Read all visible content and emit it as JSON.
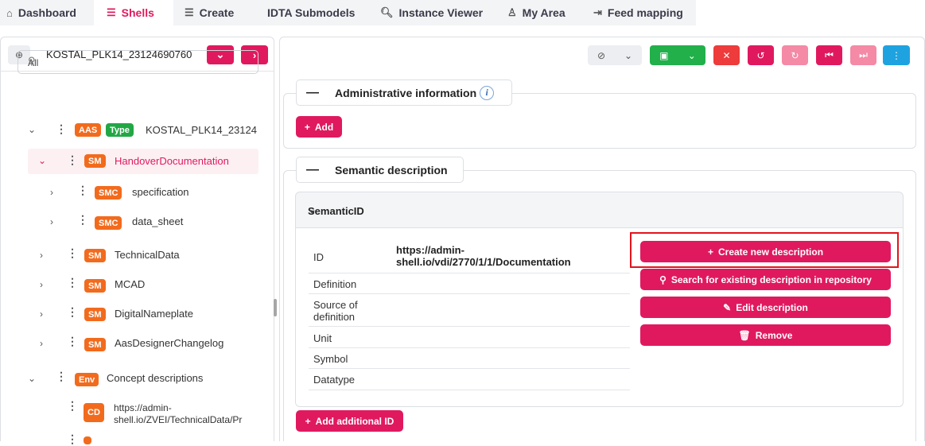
{
  "nav": {
    "tabs": [
      {
        "label": "Dashboard",
        "icon": "home-icon"
      },
      {
        "label": "Shells",
        "icon": "list-icon"
      },
      {
        "label": "Create",
        "icon": "list-icon"
      },
      {
        "label": "IDTA Submodels",
        "icon": ""
      },
      {
        "label": "Instance Viewer",
        "icon": "search-icon"
      },
      {
        "label": "My Area",
        "icon": "user-icon"
      },
      {
        "label": "Feed mapping",
        "icon": "mapping-icon"
      }
    ],
    "active": "Shells"
  },
  "left": {
    "shell_id": "KOSTAL_PLK14_23124690760",
    "filter_value": "All",
    "tree": [
      {
        "badges": [
          "AAS",
          "Type"
        ],
        "label": "KOSTAL_PLK14_23124",
        "expanded": true
      },
      {
        "badges": [
          "SM"
        ],
        "label": "HandoverDocumentation",
        "expanded": true,
        "selected": true
      },
      {
        "badges": [
          "SMC"
        ],
        "label": "specification",
        "expanded": false
      },
      {
        "badges": [
          "SMC"
        ],
        "label": "data_sheet",
        "expanded": false
      },
      {
        "badges": [
          "SM"
        ],
        "label": "TechnicalData",
        "expanded": false
      },
      {
        "badges": [
          "SM"
        ],
        "label": "MCAD",
        "expanded": false
      },
      {
        "badges": [
          "SM"
        ],
        "label": "DigitalNameplate",
        "expanded": false
      },
      {
        "badges": [
          "SM"
        ],
        "label": "AasDesignerChangelog",
        "expanded": false
      },
      {
        "badges": [
          "Env"
        ],
        "label": "Concept descriptions",
        "expanded": true
      },
      {
        "badges": [
          "CD"
        ],
        "label_line1": "https://admin-",
        "label_line2": "shell.io/ZVEI/TechnicalData/Pr"
      }
    ]
  },
  "right": {
    "admin_section": {
      "title": "Administrative information",
      "add_label": "Add"
    },
    "semantic_section": {
      "title": "Semantic description",
      "panel_title": "SemanticID",
      "properties": [
        {
          "key": "ID",
          "value_line1": "https://admin-",
          "value_line2": "shell.io/vdi/2770/1/1/Documentation"
        },
        {
          "key": "Definition",
          "value": ""
        },
        {
          "key_line1": "Source of",
          "key_line2": "definition",
          "value": ""
        },
        {
          "key": "Unit",
          "value": ""
        },
        {
          "key": "Symbol",
          "value": ""
        },
        {
          "key": "Datatype",
          "value": ""
        }
      ],
      "actions": [
        {
          "label": "Create new description",
          "icon": "plus-icon"
        },
        {
          "label": "Search for existing description in repository",
          "icon": "search-icon"
        },
        {
          "label": "Edit description",
          "icon": "pencil-icon"
        },
        {
          "label": "Remove",
          "icon": "trash-icon"
        }
      ],
      "add_id_label": "Add additional ID"
    }
  },
  "colors": {
    "accent": "#e0195f",
    "green": "#22b04b",
    "red": "#ee3b3b",
    "light_pink": "#f48aa6",
    "blue": "#1fa3e0",
    "highlight": "#e3141e"
  }
}
